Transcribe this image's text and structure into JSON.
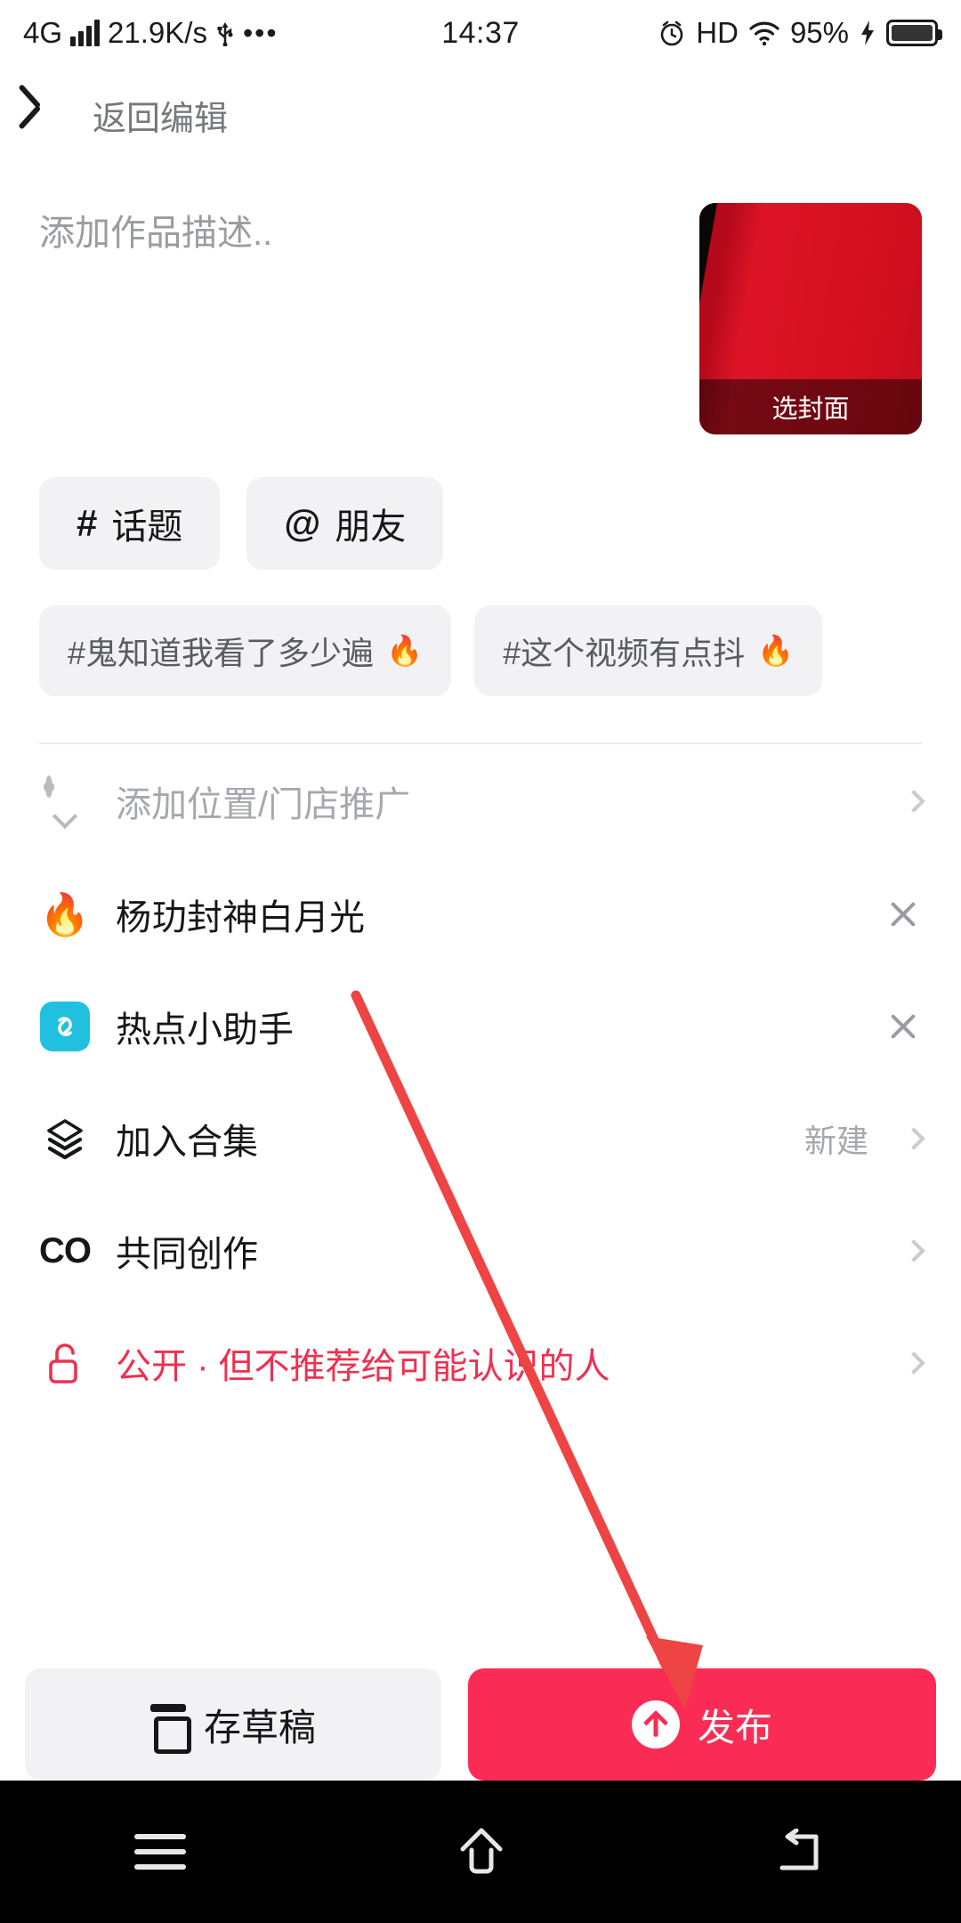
{
  "statusbar": {
    "network_type": "4G",
    "speed": "21.9K/s",
    "usb_icon": "usb-icon",
    "more_icon": "ellipsis-icon",
    "time": "14:37",
    "alarm_icon": "alarm-icon",
    "hd_label": "HD",
    "wifi_icon": "wifi-icon",
    "battery_percent": "95%",
    "charging_icon": "lightning-icon"
  },
  "header": {
    "back_icon": "chevron-left-icon",
    "title": "返回编辑"
  },
  "description": {
    "placeholder": "添加作品描述..",
    "value": ""
  },
  "cover": {
    "label": "选封面",
    "accent": "#d5111f"
  },
  "chips": [
    {
      "symbol": "#",
      "label": "话题",
      "name": "topic-chip"
    },
    {
      "symbol": "@",
      "label": "朋友",
      "name": "friend-chip"
    }
  ],
  "suggestions": [
    {
      "label": "#鬼知道我看了多少遍",
      "icon": "flame-icon"
    },
    {
      "label": "#这个视频有点抖",
      "icon": "flame-icon"
    }
  ],
  "rows": [
    {
      "name": "location-row",
      "icon": "location-pin-icon",
      "label": "添加位置/门店推广",
      "muted": true,
      "trailing": "",
      "control": "chevron"
    },
    {
      "name": "hot-topic-row",
      "icon": "flame-emoji-icon",
      "label": "杨玏封神白月光",
      "muted": false,
      "trailing": "",
      "control": "close"
    },
    {
      "name": "hot-assistant-row",
      "icon": "hot-assistant-app-icon",
      "label": "热点小助手",
      "muted": false,
      "trailing": "",
      "control": "close"
    },
    {
      "name": "collection-row",
      "icon": "layers-icon",
      "label": "加入合集",
      "muted": false,
      "trailing": "新建",
      "control": "chevron"
    },
    {
      "name": "co-creation-row",
      "icon": "co-icon",
      "label": "共同创作",
      "muted": false,
      "trailing": "",
      "control": "chevron"
    },
    {
      "name": "privacy-row",
      "icon": "unlock-icon",
      "label": "公开 · 但不推荐给可能认识的人",
      "muted": false,
      "danger": true,
      "trailing": "",
      "control": "chevron"
    }
  ],
  "actions": {
    "draft_label": "存草稿",
    "draft_icon": "draft-box-icon",
    "publish_label": "发布",
    "publish_icon": "upload-arrow-icon",
    "publish_color": "#fa2c55"
  },
  "navbar": {
    "menu_icon": "recents-icon",
    "home_icon": "home-icon",
    "back_icon": "back-icon"
  },
  "annotation": {
    "color": "#ee4444",
    "description": "red arrow pointing to publish button"
  }
}
